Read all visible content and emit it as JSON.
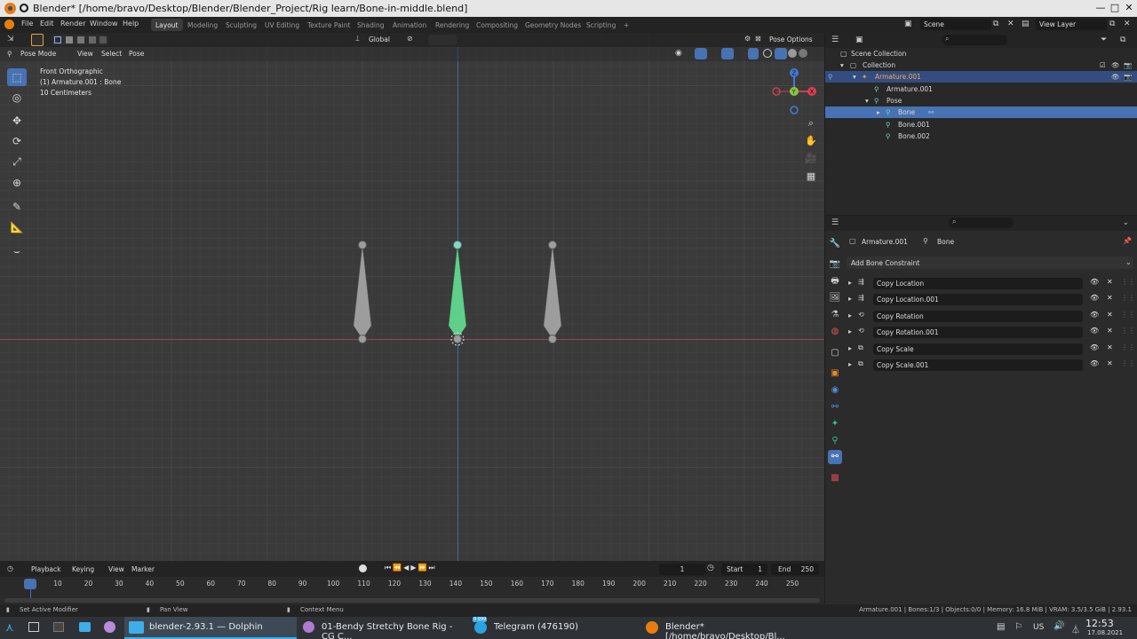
{
  "window": {
    "title": "Blender* [/home/bravo/Desktop/Blender/Blender_Project/Rig learn/Bone-in-middle.blend]",
    "minimize": "—",
    "maximize": "□",
    "close": "✕"
  },
  "menu": {
    "items": [
      "File",
      "Edit",
      "Render",
      "Window",
      "Help"
    ],
    "workspaces": [
      "Layout",
      "Modeling",
      "Sculpting",
      "UV Editing",
      "Texture Paint",
      "Shading",
      "Animation",
      "Rendering",
      "Compositing",
      "Geometry Nodes",
      "Scripting"
    ],
    "active_workspace": "Layout",
    "add_tab": "+",
    "scene_label": "Scene",
    "view_layer_label": "View Layer"
  },
  "viewport": {
    "mode": "Pose Mode",
    "menus": [
      "View",
      "Select",
      "Pose"
    ],
    "orientation": "Global",
    "pose_options": "Pose Options",
    "overlay_lines": [
      "Front Orthographic",
      "(1) Armature.001 : Bone",
      "10 Centimeters"
    ],
    "gizmo": {
      "z": "Z",
      "y": "Y",
      "x": "X"
    },
    "bone_color_selected": "#5fcf8a",
    "bone_color": "#9a9a9a"
  },
  "outliner": {
    "rows": [
      {
        "label": "Scene Collection"
      },
      {
        "label": "Collection"
      },
      {
        "label": "Armature.001"
      },
      {
        "label": "Armature.001"
      },
      {
        "label": "Pose"
      },
      {
        "label": "Bone"
      },
      {
        "label": "Bone.001"
      },
      {
        "label": "Bone.002"
      }
    ]
  },
  "properties": {
    "breadcrumb_object": "Armature.001",
    "breadcrumb_bone": "Bone",
    "add_constraint": "Add Bone Constraint",
    "constraints": [
      "Copy Location",
      "Copy Location.001",
      "Copy Rotation",
      "Copy Rotation.001",
      "Copy Scale",
      "Copy Scale.001"
    ]
  },
  "timeline": {
    "menus": [
      "Playback",
      "Keying",
      "View",
      "Marker"
    ],
    "current_frame": "1",
    "start_label": "Start",
    "start": "1",
    "end_label": "End",
    "end": "250",
    "ticks": [
      "1",
      "10",
      "20",
      "30",
      "40",
      "50",
      "60",
      "70",
      "80",
      "90",
      "100",
      "110",
      "120",
      "130",
      "140",
      "150",
      "160",
      "170",
      "180",
      "190",
      "200",
      "210",
      "220",
      "230",
      "240",
      "250"
    ]
  },
  "status": {
    "left": "Set Active Modifier",
    "middle": "Pan View",
    "right_ctx": "Context Menu",
    "stats": "Armature.001 | Bones:1/3 | Objects:0/0 | Memory: 16.8 MiB | VRAM: 3.5/3.5 GiB | 2.93.1"
  },
  "taskbar": {
    "tasks": [
      {
        "label": "blender-2.93.1 — Dolphin"
      },
      {
        "label": "01-Bendy Stretchy Bone Rig - CG C..."
      },
      {
        "label": "Telegram (476190)"
      },
      {
        "label": "Blender* [/home/bravo/Desktop/Bl..."
      }
    ],
    "telegram_badge": "9 999",
    "keyboard_layout": "US",
    "time": "12:53",
    "date": "17.08.2021"
  }
}
